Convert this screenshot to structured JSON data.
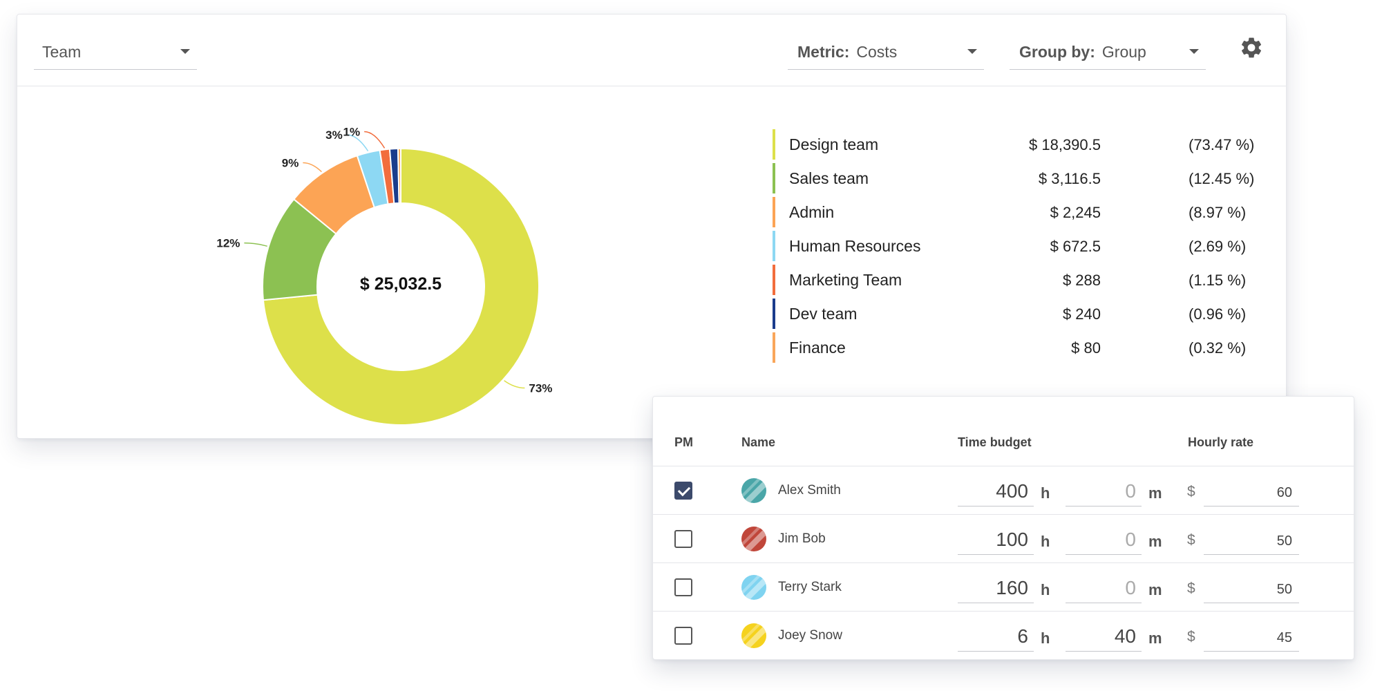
{
  "toolbar": {
    "team_select": {
      "value": "Team"
    },
    "metric_select": {
      "label": "Metric:",
      "value": "Costs"
    },
    "group_select": {
      "label": "Group by:",
      "value": "Group"
    }
  },
  "donut": {
    "center_total": "$ 25,032.5"
  },
  "chart_data": {
    "type": "pie",
    "total": 25032.5,
    "slices": [
      {
        "name": "Design team",
        "value": 18390.5,
        "percent": 73.47,
        "label": "73%",
        "color": "#dde04a"
      },
      {
        "name": "Sales team",
        "value": 3116.5,
        "percent": 12.45,
        "label": "12%",
        "color": "#8cc152"
      },
      {
        "name": "Admin",
        "value": 2245,
        "percent": 8.97,
        "label": "9%",
        "color": "#fca455"
      },
      {
        "name": "Human Resources",
        "value": 672.5,
        "percent": 2.69,
        "label": "3%",
        "color": "#8dd8f3"
      },
      {
        "name": "Marketing Team",
        "value": 288,
        "percent": 1.15,
        "label": "1%",
        "color": "#f26d3d"
      },
      {
        "name": "Dev team",
        "value": 240,
        "percent": 0.96,
        "label": "",
        "color": "#1b3c8c"
      },
      {
        "name": "Finance",
        "value": 80,
        "percent": 0.32,
        "label": "",
        "color": "#f9a65a"
      }
    ]
  },
  "legend": [
    {
      "name": "Design team",
      "value": "$ 18,390.5",
      "pct": "(73.47 %)",
      "color": "#dde04a"
    },
    {
      "name": "Sales team",
      "value": "$ 3,116.5",
      "pct": "(12.45 %)",
      "color": "#8cc152"
    },
    {
      "name": "Admin",
      "value": "$ 2,245",
      "pct": "(8.97 %)",
      "color": "#fca455"
    },
    {
      "name": "Human Resources",
      "value": "$ 672.5",
      "pct": "(2.69 %)",
      "color": "#8dd8f3"
    },
    {
      "name": "Marketing Team",
      "value": "$ 288",
      "pct": "(1.15 %)",
      "color": "#f26d3d"
    },
    {
      "name": "Dev team",
      "value": "$ 240",
      "pct": "(0.96 %)",
      "color": "#1b3c8c"
    },
    {
      "name": "Finance",
      "value": "$ 80",
      "pct": "(0.32 %)",
      "color": "#f9a65a"
    }
  ],
  "table": {
    "headers": {
      "pm": "PM",
      "name": "Name",
      "time_budget": "Time budget",
      "hourly_rate": "Hourly rate"
    },
    "hours_unit": "h",
    "minutes_unit": "m",
    "currency": "$",
    "rows": [
      {
        "pm": true,
        "name": "Alex Smith",
        "hours": "400",
        "minutes": "0",
        "rate": "60",
        "avatar_color": "#4aa6a8"
      },
      {
        "pm": false,
        "name": "Jim Bob",
        "hours": "100",
        "minutes": "0",
        "rate": "50",
        "avatar_color": "#c0463a"
      },
      {
        "pm": false,
        "name": "Terry Stark",
        "hours": "160",
        "minutes": "0",
        "rate": "50",
        "avatar_color": "#7fd3f0"
      },
      {
        "pm": false,
        "name": "Joey Snow",
        "hours": "6",
        "minutes": "40",
        "rate": "45",
        "avatar_color": "#f5d21e"
      }
    ]
  }
}
